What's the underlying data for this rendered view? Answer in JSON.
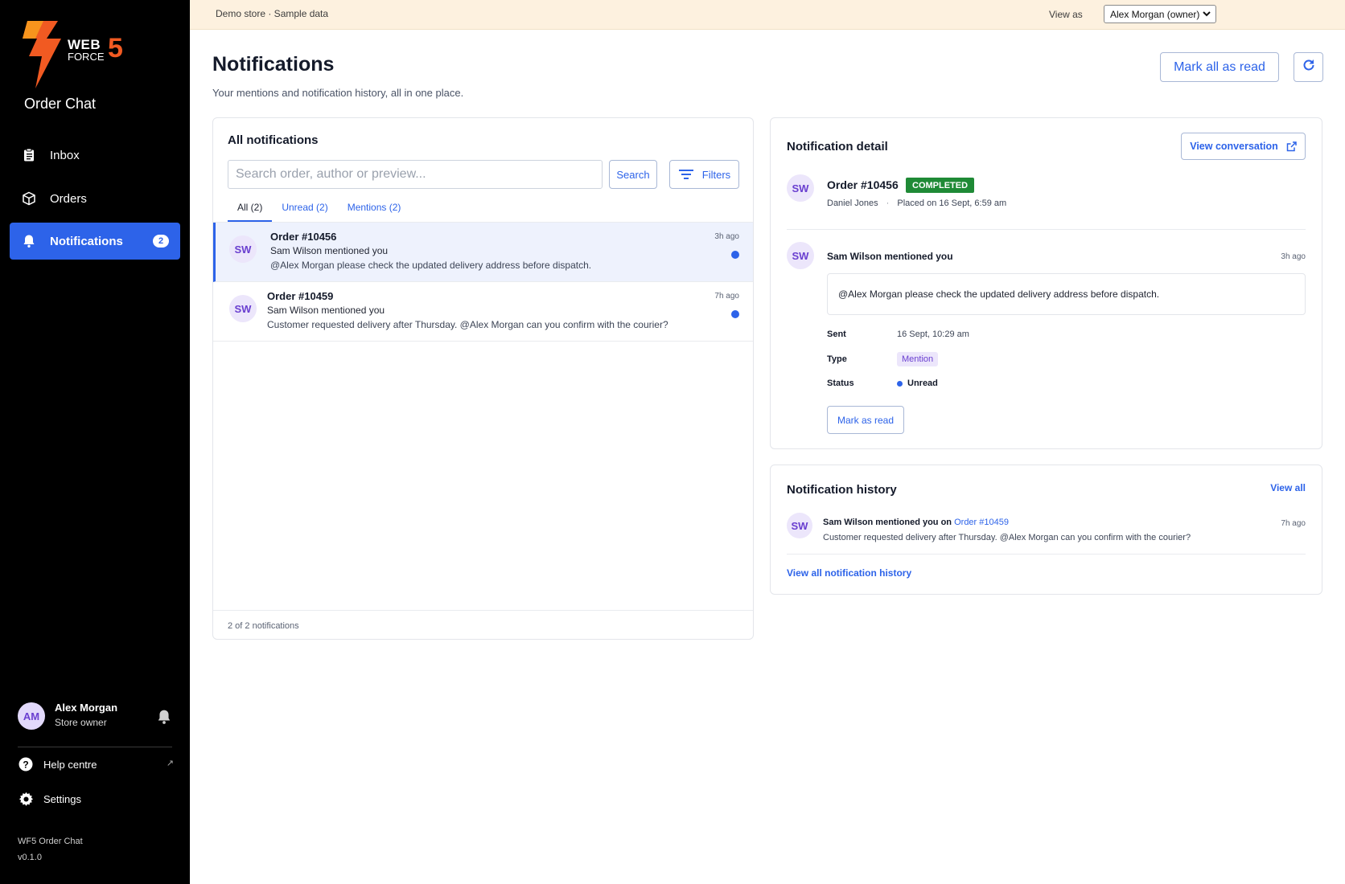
{
  "brand": {
    "logo_web": "WEB",
    "logo_force": "FORCE",
    "logo_number": "5",
    "app_name": "Order Chat",
    "accent": "#2d63e9",
    "logo_orange": "#f15a22"
  },
  "sidebar": {
    "items": [
      {
        "label": "Inbox",
        "icon": "clipboard-icon"
      },
      {
        "label": "Orders",
        "icon": "box-icon"
      },
      {
        "label": "Notifications",
        "icon": "bell-icon",
        "badge": "2",
        "active": true
      }
    ],
    "user": {
      "initials": "AM",
      "name": "Alex Morgan",
      "role": "Store owner"
    },
    "links": [
      {
        "label": "Help centre",
        "icon": "help-icon",
        "external": "↗"
      },
      {
        "label": "Settings",
        "icon": "gear-icon"
      }
    ],
    "version_name": "WF5 Order Chat",
    "version": "v0.1.0"
  },
  "banner": {
    "text": "Demo store · Sample data",
    "view_as_label": "View as",
    "view_as_value": "Alex Morgan (owner)"
  },
  "header": {
    "title": "Notifications",
    "subtitle": "Your mentions and notification history, all in one place.",
    "mark_all_label": "Mark all as read"
  },
  "list": {
    "title": "All notifications",
    "search_placeholder": "Search order, author or preview...",
    "search_label": "Search",
    "filters_label": "Filters",
    "tabs": [
      {
        "label": "All (2)",
        "active": true
      },
      {
        "label": "Unread (2)"
      },
      {
        "label": "Mentions (2)"
      }
    ],
    "rows": [
      {
        "initials": "SW",
        "order": "Order #10456",
        "author": "Sam Wilson mentioned you",
        "preview": "@Alex Morgan please check the updated delivery address before dispatch.",
        "time": "3h ago",
        "unread": true,
        "selected": true
      },
      {
        "initials": "SW",
        "order": "Order #10459",
        "author": "Sam Wilson mentioned you",
        "preview": "Customer requested delivery after Thursday. @Alex Morgan can you confirm with the courier?",
        "time": "7h ago",
        "unread": true,
        "selected": false
      }
    ],
    "footer": "2 of 2 notifications"
  },
  "detail": {
    "title": "Notification detail",
    "view_conversation_label": "View conversation",
    "initials": "SW",
    "order": "Order #10456",
    "status": "COMPLETED",
    "status_color": "#1f8a36",
    "customer": "Daniel Jones",
    "placed": "Placed on 16 Sept, 6:59 am",
    "separator": "·",
    "mention_author": "Sam Wilson mentioned you",
    "mention_time": "3h ago",
    "message": "@Alex Morgan please check the updated delivery address before dispatch.",
    "sent_label": "Sent",
    "sent_value": "16 Sept, 10:29 am",
    "type_label": "Type",
    "type_value": "Mention",
    "status_label": "Status",
    "status_value": "Unread",
    "mark_read_label": "Mark as read"
  },
  "history": {
    "title": "Notification history",
    "view_all_label": "View all",
    "items": [
      {
        "initials": "SW",
        "author_text": "Sam Wilson mentioned you on",
        "order_link": "Order #10459",
        "preview": "Customer requested delivery after Thursday. @Alex Morgan can you confirm with the courier?",
        "time": "7h ago"
      }
    ],
    "view_all_history_label": "View all notification history"
  }
}
